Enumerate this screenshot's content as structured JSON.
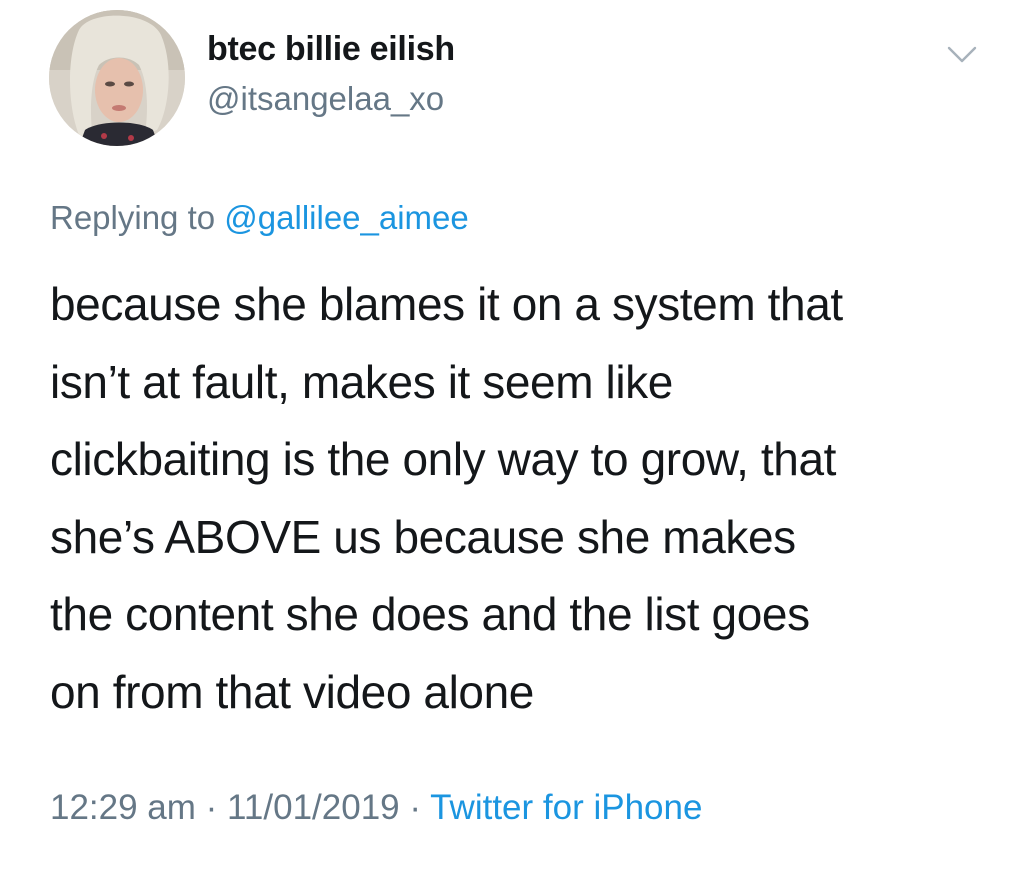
{
  "user": {
    "display_name": "btec billie eilish",
    "handle": "@itsangelaa_xo"
  },
  "reply": {
    "prefix": "Replying to",
    "mention": "@gallilee_aimee"
  },
  "tweet": {
    "lines": [
      "because she blames it on a system that",
      "isn’t at fault, makes it seem like",
      "clickbaiting is the only way to grow, that",
      "she’s ABOVE us because she makes",
      "the content she does and the list goes",
      "on from that video alone"
    ]
  },
  "meta": {
    "time": "12:29 am",
    "sep1": " · ",
    "date": "11/01/2019",
    "sep2": " · ",
    "source": "Twitter for iPhone"
  },
  "colors": {
    "text": "#14171a",
    "secondary": "#657786",
    "link": "#1b95e0"
  },
  "icons": {
    "menu": "chevron-down-icon"
  }
}
